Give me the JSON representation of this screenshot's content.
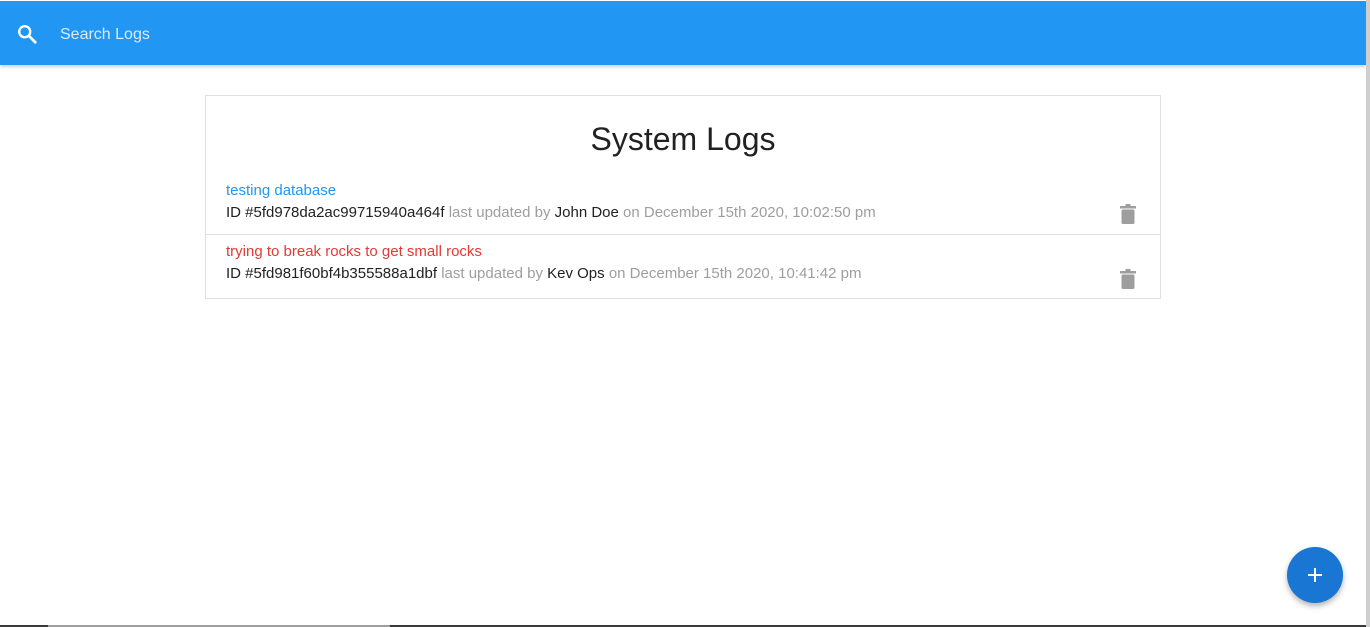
{
  "search": {
    "placeholder": "Search Logs"
  },
  "page": {
    "title": "System Logs"
  },
  "logs": [
    {
      "message": "testing database",
      "message_color": "#2196f3",
      "id_label": "ID #5fd978da2ac99715940a464f",
      "updated_text": "last updated by",
      "tech": "John Doe",
      "date_text": "on December 15th 2020, 10:02:50 pm"
    },
    {
      "message": "trying to break rocks to get small rocks",
      "message_color": "#e53935",
      "id_label": "ID #5fd981f60bf4b355588a1dbf",
      "updated_text": "last updated by",
      "tech": "Kev Ops",
      "date_text": "on December 15th 2020, 10:41:42 pm"
    }
  ],
  "icons": {
    "search": "search-icon",
    "delete": "delete-icon",
    "add": "add-icon"
  },
  "colors": {
    "navbar": "#2196f3",
    "fab": "#1976d2",
    "attention": "#e53935",
    "normal": "#2196f3"
  }
}
